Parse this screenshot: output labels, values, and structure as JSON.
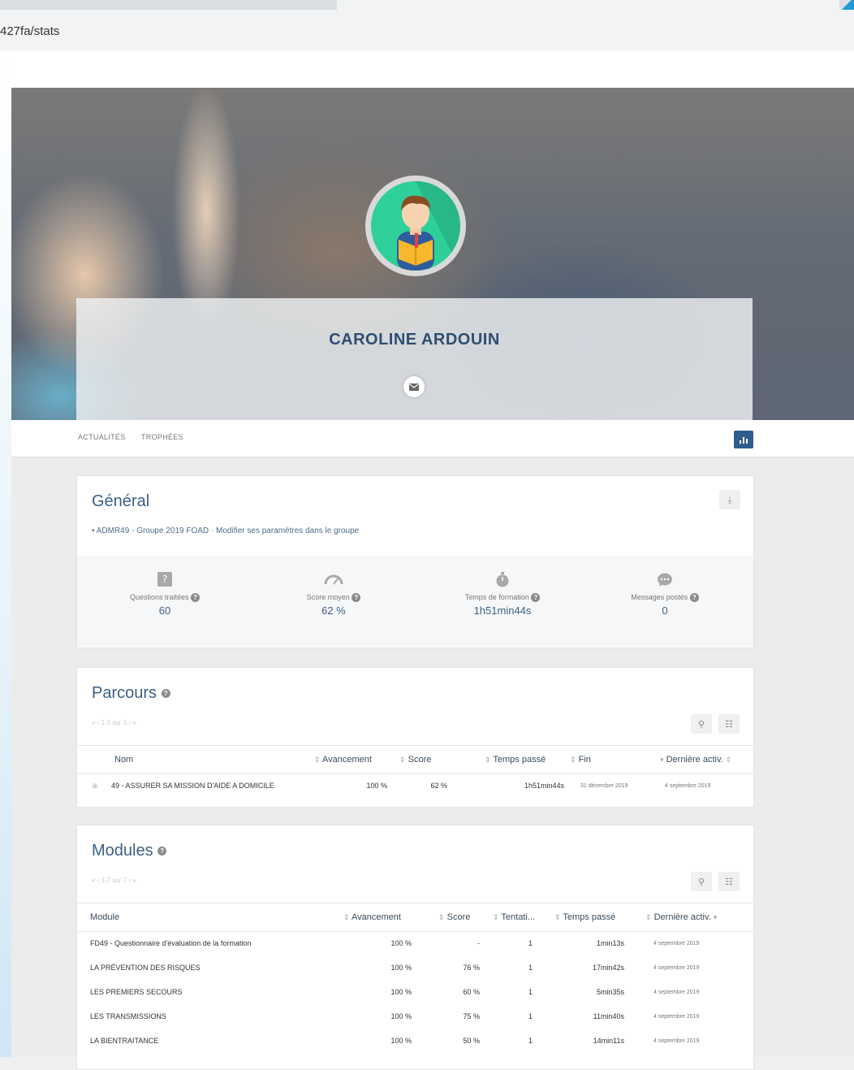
{
  "browser": {
    "url": "427fa/stats"
  },
  "profile": {
    "name": "CAROLINE ARDOUIN"
  },
  "tabs": [
    {
      "label": "ACTUALITÉS"
    },
    {
      "label": "TROPHÉES"
    }
  ],
  "general": {
    "title": "Général",
    "group_name": "ADMR49 - Groupe 2019 FOAD",
    "group_separator": "·",
    "group_link": "Modifier ses paramètres dans le groupe",
    "stats": [
      {
        "label": "Questions traitées",
        "value": "60",
        "icon": "question-icon"
      },
      {
        "label": "Score moyen",
        "value": "62 %",
        "icon": "gauge-icon"
      },
      {
        "label": "Temps de formation",
        "value": "1h51min44s",
        "icon": "stopwatch-icon"
      },
      {
        "label": "Messages postés",
        "value": "0",
        "icon": "chat-icon"
      }
    ]
  },
  "parcours": {
    "title": "Parcours",
    "pager": "1-1 sur 1",
    "columns": [
      "Nom",
      "Avancement",
      "Score",
      "Temps passé",
      "Fin",
      "Dernière activ."
    ],
    "rows": [
      {
        "name": "49 - ASSURER SA MISSION D'AIDE A DOMICILE",
        "progress": "100 %",
        "score": "62 %",
        "time": "1h51min44s",
        "end": "31 décembre 2019",
        "last": "4 septembre 2019"
      }
    ]
  },
  "modules": {
    "title": "Modules",
    "pager": "1-7 sur 7",
    "columns": [
      "Module",
      "Avancement",
      "Score",
      "Tentati...",
      "Temps passé",
      "Dernière activ."
    ],
    "rows": [
      {
        "name": "FD49 - Questionnaire d'évaluation de la formation",
        "progress": "100 %",
        "score": "-",
        "attempts": "1",
        "time": "1min13s",
        "last": "4 septembre 2019"
      },
      {
        "name": "LA PRÉVENTION DES RISQUES",
        "progress": "100 %",
        "score": "76 %",
        "attempts": "1",
        "time": "17min42s",
        "last": "4 septembre 2019"
      },
      {
        "name": "LES PREMIERS SECOURS",
        "progress": "100 %",
        "score": "60 %",
        "attempts": "1",
        "time": "5min35s",
        "last": "4 septembre 2019"
      },
      {
        "name": "LES TRANSMISSIONS",
        "progress": "100 %",
        "score": "75 %",
        "attempts": "1",
        "time": "11min40s",
        "last": "4 septembre 2019"
      },
      {
        "name": "LA BIENTRAITANCE",
        "progress": "100 %",
        "score": "50 %",
        "attempts": "1",
        "time": "14min11s",
        "last": "4 septembre 2019"
      }
    ]
  },
  "colors": {
    "accent": "#2f5d8c",
    "title": "#3a5f85",
    "avatar_bg": "#2fcf9a"
  }
}
